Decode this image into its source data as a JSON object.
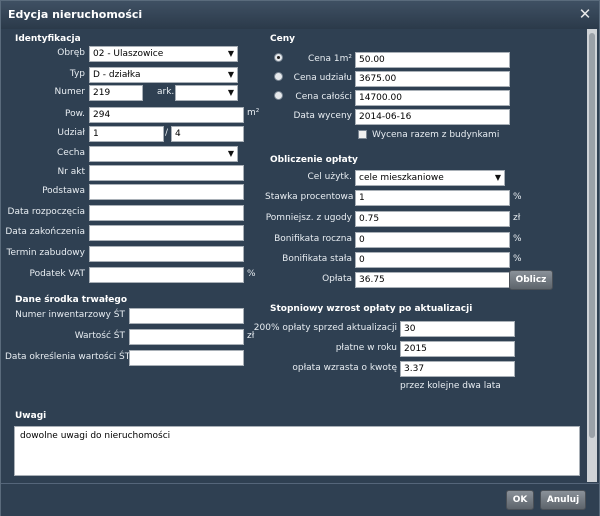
{
  "title": "Edycja nieruchomości",
  "identyfikacja": {
    "heading": "Identyfikacja",
    "obreb_label": "Obręb",
    "obreb_value": "02 - Ulaszowice",
    "typ_label": "Typ",
    "typ_value": "D - działka",
    "numer_label": "Numer",
    "numer_value": "219",
    "ark_label": "ark.",
    "ark_value": "",
    "pow_label": "Pow.",
    "pow_value": "294",
    "pow_unit": "m²",
    "udzial_label": "Udział",
    "udzial_num": "1",
    "udzial_sep": "/",
    "udzial_den": "4",
    "cecha_label": "Cecha",
    "cecha_value": "",
    "nr_akt_label": "Nr akt",
    "nr_akt_value": "",
    "podstawa_label": "Podstawa",
    "podstawa_value": "",
    "data_rozp_label": "Data rozpoczęcia",
    "data_rozp_value": "",
    "data_zak_label": "Data zakończenia",
    "data_zak_value": "",
    "termin_label": "Termin zabudowy",
    "termin_value": "",
    "vat_label": "Podatek VAT",
    "vat_value": "",
    "vat_unit": "%"
  },
  "srodek": {
    "heading": "Dane środka trwałego",
    "nr_inw_label": "Numer inwentarzowy ŚT",
    "nr_inw_value": "",
    "wartosc_label": "Wartość ŚT",
    "wartosc_value": "",
    "wartosc_unit": "zł",
    "data_okr_label": "Data określenia wartości ŚT",
    "data_okr_value": ""
  },
  "ceny": {
    "heading": "Ceny",
    "cena_m2_label": "Cena 1m²",
    "cena_m2_value": "50.00",
    "cena_udz_label": "Cena udziału",
    "cena_udz_value": "3675.00",
    "cena_cal_label": "Cena całości",
    "cena_cal_value": "14700.00",
    "data_wyc_label": "Data wyceny",
    "data_wyc_value": "2014-06-16",
    "wycena_label": "Wycena razem z budynkami"
  },
  "oplata": {
    "heading": "Obliczenie opłaty",
    "cel_label": "Cel użytk.",
    "cel_value": "cele mieszkaniowe",
    "stawka_label": "Stawka procentowa",
    "stawka_value": "1",
    "stawka_unit": "%",
    "pomn_label": "Pomniejsz. z ugody",
    "pomn_value": "0.75",
    "pomn_unit": "zł",
    "bon_r_label": "Bonifikata roczna",
    "bon_r_value": "0",
    "bon_r_unit": "%",
    "bon_s_label": "Bonifikata stała",
    "bon_s_value": "0",
    "bon_s_unit": "%",
    "oplata_label": "Opłata",
    "oplata_value": "36.75",
    "oblicz": "Oblicz"
  },
  "wzrost": {
    "heading": "Stopniowy wzrost opłaty po aktualizacji",
    "proc_label": "200% opłaty sprzed aktualizacji",
    "proc_value": "30",
    "rok_label": "płatne w roku",
    "rok_value": "2015",
    "kwota_label": "opłata wzrasta o kwotę",
    "kwota_value": "3.37",
    "note": "przez kolejne dwa lata"
  },
  "uwagi": {
    "heading": "Uwagi",
    "value": "dowolne uwagi do nieruchomości"
  },
  "buttons": {
    "ok": "OK",
    "cancel": "Anuluj"
  }
}
